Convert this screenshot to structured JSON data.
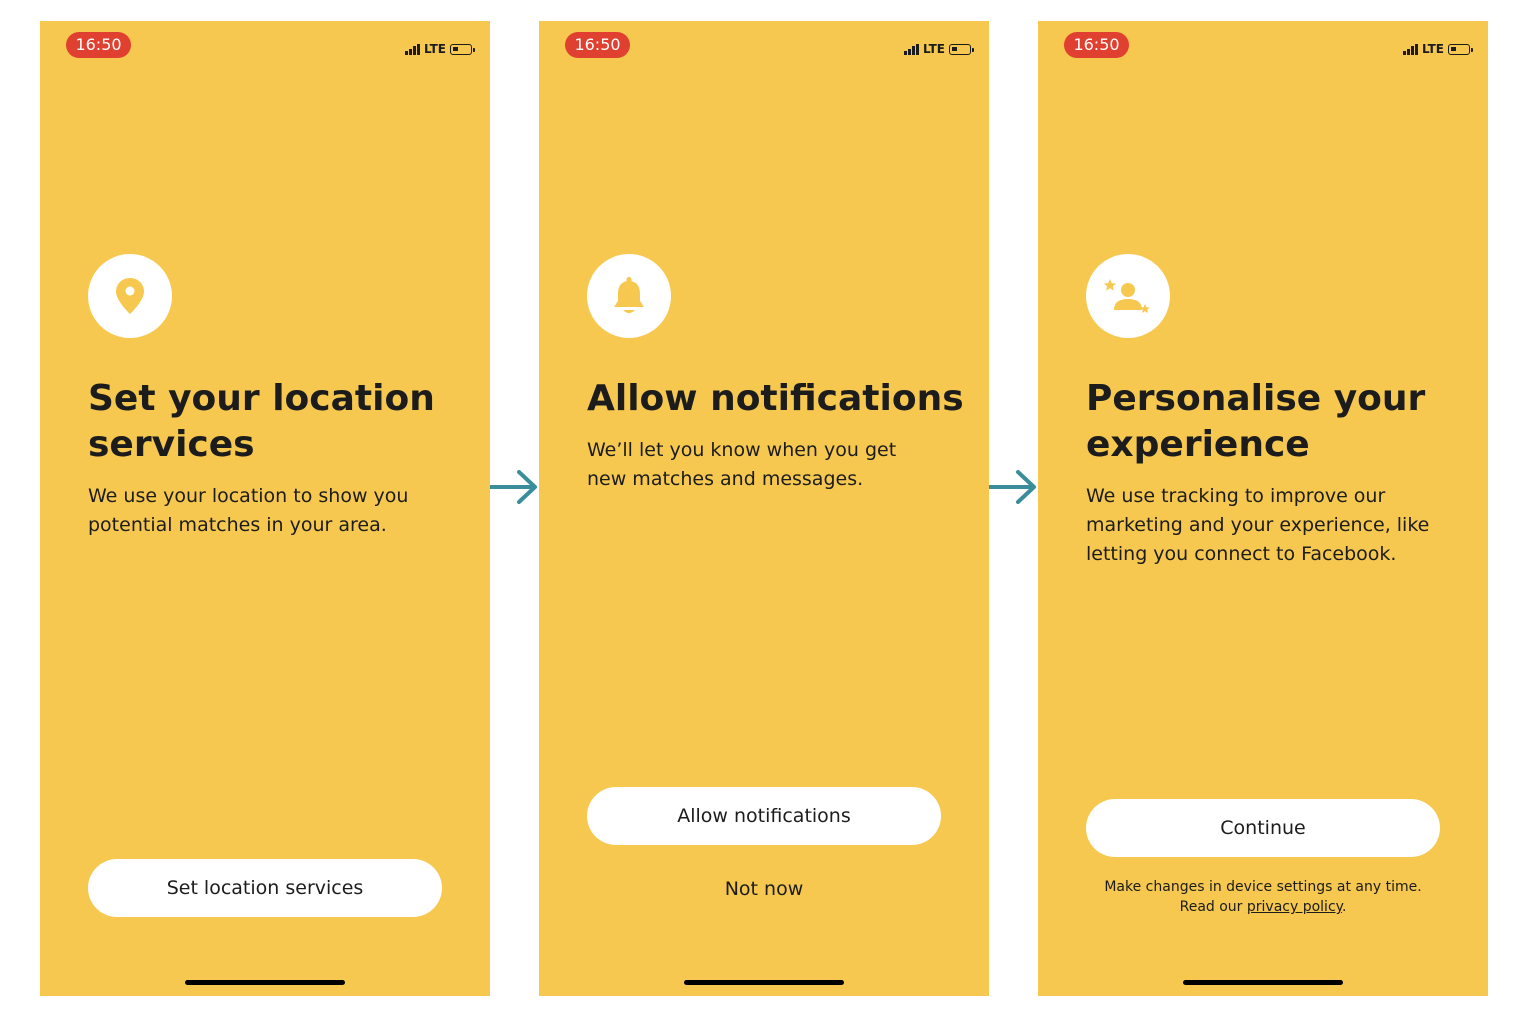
{
  "status_bar": {
    "time": "16:50",
    "network": "LTE"
  },
  "screens": [
    {
      "icon": "location-pin-icon",
      "title": "Set your location services",
      "description": "We use your location to show you potential matches in your area.",
      "primary_button": "Set location services"
    },
    {
      "icon": "bell-icon",
      "title": "Allow notifications",
      "description": "We’ll let you know when you get new matches and messages.",
      "primary_button": "Allow notifications",
      "secondary_button": "Not now"
    },
    {
      "icon": "person-stars-icon",
      "title": "Personalise your experience",
      "description": "We use tracking to improve our marketing and your experience, like letting you connect to Facebook.",
      "primary_button": "Continue",
      "footnote_line1": "Make changes in device settings at any time.",
      "footnote_prefix": "Read our ",
      "footnote_link": "privacy policy",
      "footnote_suffix": "."
    }
  ],
  "colors": {
    "background": "#f6c850",
    "time_badge": "#e0402f",
    "arrow": "#3a8e9c",
    "button": "#ffffff"
  }
}
